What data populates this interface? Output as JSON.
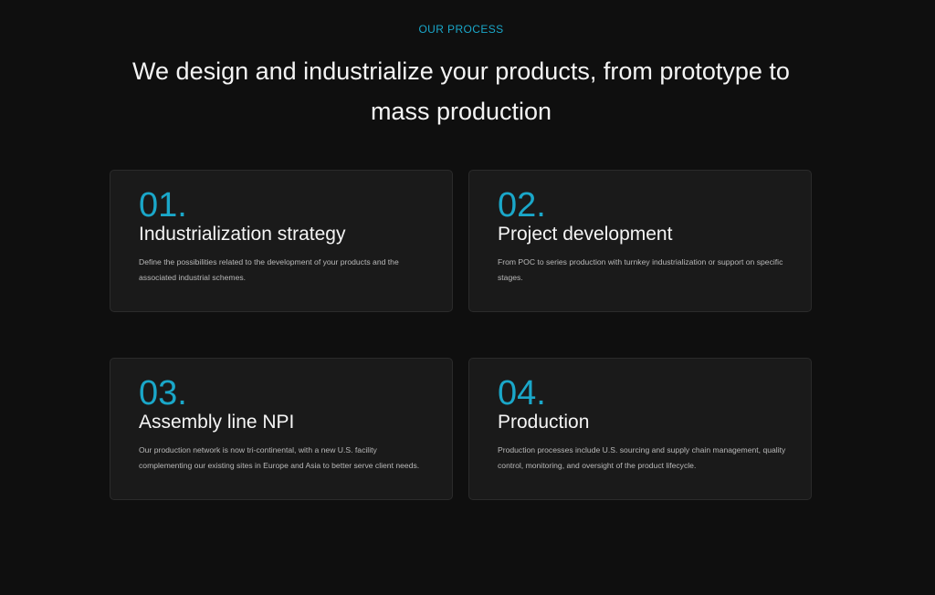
{
  "section": {
    "eyebrow": "OUR PROCESS",
    "headline": "We design and industrialize your products, from prototype to mass production"
  },
  "cards": [
    {
      "number": "01.",
      "title": "Industrialization strategy",
      "description": "Define the possibilities related to the development of your products and the associated industrial schemes."
    },
    {
      "number": "02.",
      "title": "Project development",
      "description": "From POC to series production with turnkey industrialization or support on specific stages."
    },
    {
      "number": "03.",
      "title": "Assembly line NPI",
      "description": "Our production network is now tri-continental, with a new U.S. facility complementing our existing sites in Europe and Asia to better serve client needs."
    },
    {
      "number": "04.",
      "title": "Production",
      "description": "Production processes include U.S. sourcing and supply chain management, quality control, monitoring, and oversight of the product lifecycle."
    }
  ],
  "colors": {
    "background": "#0f0f0f",
    "card_background": "#1a1a1a",
    "accent": "#1aa7c9",
    "heading_text": "#f4f4f4",
    "body_text": "#b9b9b9"
  }
}
